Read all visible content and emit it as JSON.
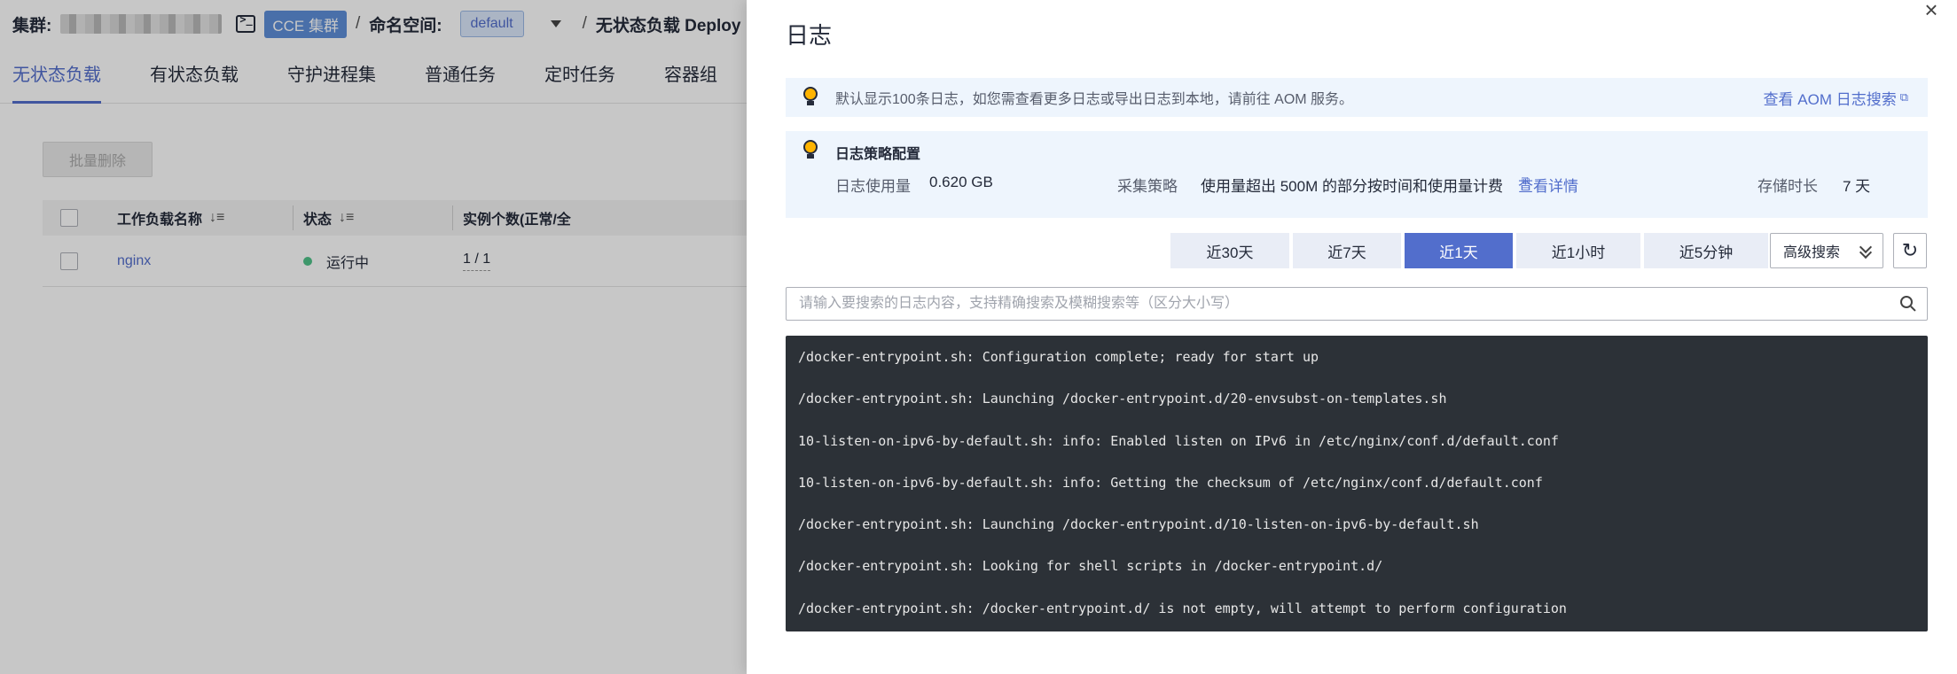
{
  "background": {
    "cluster_label": "集群:",
    "cluster_tag": "CCE 集群",
    "sep1": "/",
    "namespace_label": "命名空间:",
    "namespace_value": "default",
    "sep2": "/",
    "breadcrumb_tail": "无状态负载 Deploy",
    "tabs": [
      "无状态负载",
      "有状态负载",
      "守护进程集",
      "普通任务",
      "定时任务",
      "容器组"
    ],
    "batch_delete": "批量删除",
    "table": {
      "headers": [
        "工作负载名称",
        "状态",
        "实例个数(正常/全"
      ],
      "rows": [
        {
          "name": "nginx",
          "status": "运行中",
          "instances": "1 / 1"
        }
      ]
    }
  },
  "drawer": {
    "title": "日志",
    "notice": {
      "text": "默认显示100条日志，如您需查看更多日志或导出日志到本地，请前往 AOM 服务。",
      "link": "查看 AOM 日志搜索"
    },
    "policy": {
      "title": "日志策略配置",
      "usage_label": "日志使用量",
      "usage_value": "0.620 GB",
      "strategy_label": "采集策略",
      "strategy_value": "使用量超出 500M 的部分按时间和使用量计费",
      "strategy_link": "查看详情",
      "retention_label": "存储时长",
      "retention_value": "7 天"
    },
    "time_ranges": [
      "近30天",
      "近7天",
      "近1天",
      "近1小时",
      "近5分钟"
    ],
    "active_range": "近1天",
    "advanced_search": "高级搜索",
    "search_placeholder": "请输入要搜索的日志内容，支持精确搜索及模糊搜索等（区分大小写）",
    "logs": [
      "/docker-entrypoint.sh: Configuration complete; ready for start up",
      "/docker-entrypoint.sh: Launching /docker-entrypoint.d/20-envsubst-on-templates.sh",
      "10-listen-on-ipv6-by-default.sh: info: Enabled listen on IPv6 in /etc/nginx/conf.d/default.conf",
      "10-listen-on-ipv6-by-default.sh: info: Getting the checksum of /etc/nginx/conf.d/default.conf",
      "/docker-entrypoint.sh: Launching /docker-entrypoint.d/10-listen-on-ipv6-by-default.sh",
      "/docker-entrypoint.sh: Looking for shell scripts in /docker-entrypoint.d/",
      "/docker-entrypoint.sh: /docker-entrypoint.d/ is not empty, will attempt to perform configuration"
    ],
    "colors": {
      "accent": "#526ecc",
      "log_bg": "#2c3137",
      "notice_bg": "#eef5fd"
    }
  }
}
